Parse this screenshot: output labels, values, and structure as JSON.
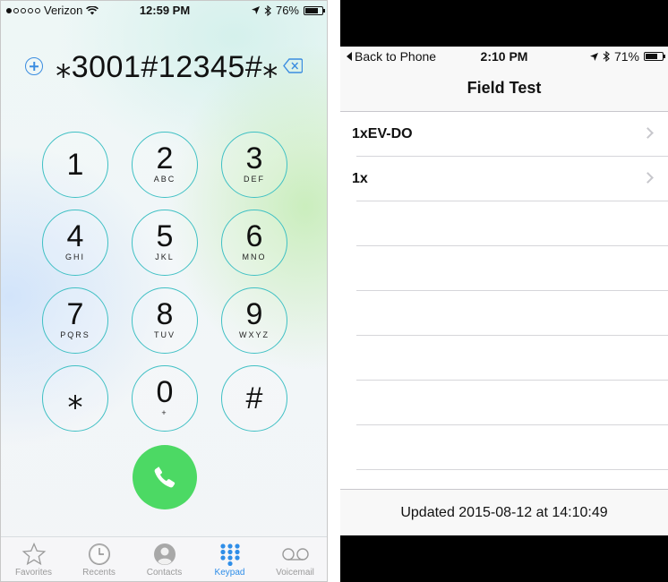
{
  "left_phone": {
    "status_bar": {
      "carrier": "Verizon",
      "time": "12:59 PM",
      "battery": "76%",
      "battery_level": 0.76
    },
    "dialed_number": "⁎3001#12345#⁎",
    "keys": [
      {
        "digit": "1",
        "letters": ""
      },
      {
        "digit": "2",
        "letters": "ABC"
      },
      {
        "digit": "3",
        "letters": "DEF"
      },
      {
        "digit": "4",
        "letters": "GHI"
      },
      {
        "digit": "5",
        "letters": "JKL"
      },
      {
        "digit": "6",
        "letters": "MNO"
      },
      {
        "digit": "7",
        "letters": "PQRS"
      },
      {
        "digit": "8",
        "letters": "TUV"
      },
      {
        "digit": "9",
        "letters": "WXYZ"
      },
      {
        "digit": "⁎",
        "letters": ""
      },
      {
        "digit": "0",
        "letters": "+"
      },
      {
        "digit": "#",
        "letters": ""
      }
    ],
    "tabs": [
      {
        "label": "Favorites",
        "icon": "star-icon"
      },
      {
        "label": "Recents",
        "icon": "clock-icon"
      },
      {
        "label": "Contacts",
        "icon": "contacts-icon"
      },
      {
        "label": "Keypad",
        "icon": "keypad-icon",
        "active": true
      },
      {
        "label": "Voicemail",
        "icon": "voicemail-icon"
      }
    ],
    "colors": {
      "key_ring": "#3fc0c4",
      "call_button": "#4cd964",
      "active_tab": "#2f8ee8"
    }
  },
  "right_phone": {
    "status_bar": {
      "back": "Back to Phone",
      "time": "2:10 PM",
      "battery": "71%",
      "battery_level": 0.71
    },
    "title": "Field Test",
    "items": [
      {
        "label": "1xEV-DO"
      },
      {
        "label": "1x"
      }
    ],
    "footer": "Updated 2015-08-12 at 14:10:49"
  }
}
